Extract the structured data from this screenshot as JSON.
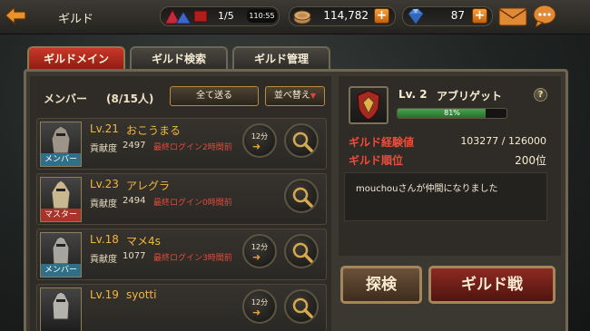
{
  "topbar": {
    "title": "ギルド",
    "stamina": "1/5",
    "stamina_timer": "110:55",
    "gold": "114,782",
    "gems": "87",
    "plus": "+"
  },
  "tabs": [
    {
      "label": "ギルドメイン",
      "active": true
    },
    {
      "label": "ギルド検索",
      "active": false
    },
    {
      "label": "ギルド管理",
      "active": false
    }
  ],
  "members_header": {
    "label": "メンバー",
    "count": "(8/15人)",
    "send_all": "全て送る",
    "sort": "並べ替え"
  },
  "members": [
    {
      "level": "Lv.21",
      "name": "おこうまる",
      "role": "メンバー",
      "contrib_label": "貢献度",
      "contrib": "2497",
      "last_login": "最終ログイン2時間前",
      "timer": "12分"
    },
    {
      "level": "Lv.23",
      "name": "アレグラ",
      "role": "マスター",
      "contrib_label": "貢献度",
      "contrib": "2494",
      "last_login": "最終ログイン0時間前",
      "timer": ""
    },
    {
      "level": "Lv.18",
      "name": "マメ4s",
      "role": "メンバー",
      "contrib_label": "貢献度",
      "contrib": "1077",
      "last_login": "最終ログイン3時間前",
      "timer": "12分"
    },
    {
      "level": "Lv.19",
      "name": "syotti",
      "role": "",
      "contrib_label": "",
      "contrib": "",
      "last_login": "",
      "timer": "12分"
    }
  ],
  "guild": {
    "level": "Lv. 2",
    "name": "アブリゲット",
    "exp_percent_text": "81%",
    "exp_fraction": 0.81,
    "exp_label": "ギルド経験値",
    "exp_value": "103277 / 126000",
    "rank_label": "ギルド順位",
    "rank_value": "200位",
    "help": "?",
    "news": "mouchouさんが仲間になりました"
  },
  "buttons": {
    "explore": "探検",
    "guild_war": "ギルド戦"
  },
  "colors": {
    "accent_red": "#ef4c38",
    "name_gold": "#f0b640",
    "exp_green": "#3c9a44",
    "member_badge": "#2f6f88",
    "master_badge": "#a8332a"
  }
}
